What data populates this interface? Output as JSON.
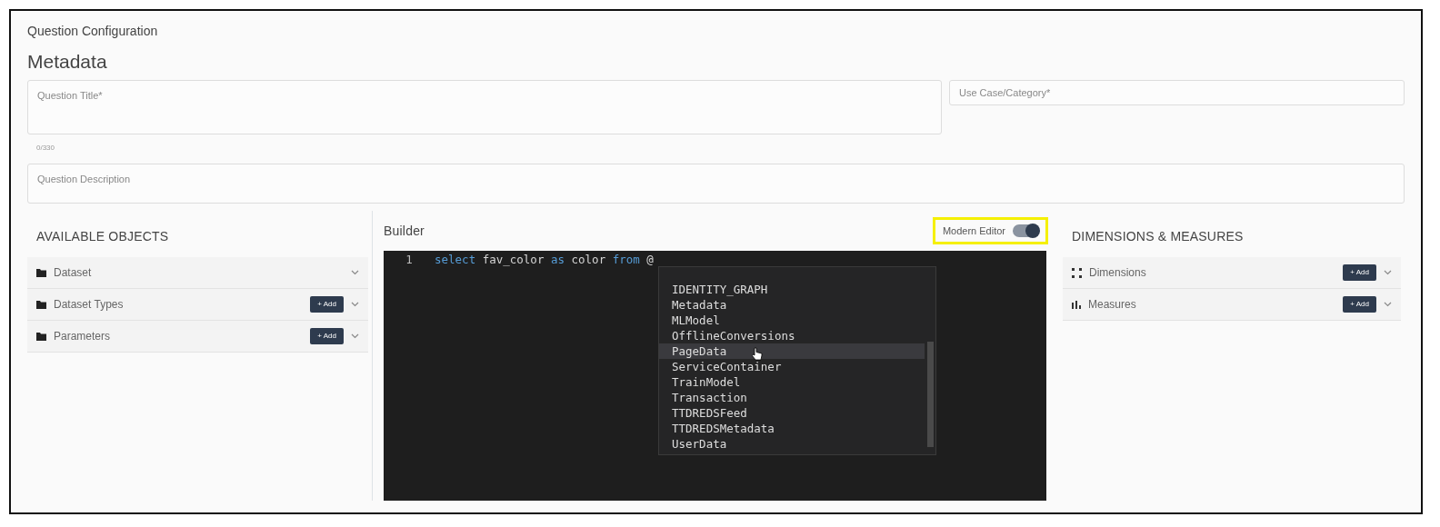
{
  "header": {
    "breadcrumb": "Question Configuration",
    "heading": "Metadata"
  },
  "metadata": {
    "title_field": {
      "placeholder": "Question Title*",
      "counter": "0/330"
    },
    "category_field": {
      "placeholder": "Use Case/Category*"
    },
    "description_field": {
      "placeholder": "Question Description"
    }
  },
  "available_objects": {
    "title": "AVAILABLE OBJECTS",
    "items": [
      {
        "label": "Dataset",
        "kind": "folder"
      },
      {
        "label": "Dataset Types",
        "kind": "folder",
        "add_button": "+ Add"
      },
      {
        "label": "Parameters",
        "kind": "folder",
        "add_button": "+ Add"
      }
    ]
  },
  "builder": {
    "title": "Builder",
    "toggle": {
      "label": "Modern Editor",
      "on": true,
      "highlighted": true
    },
    "editor": {
      "lines": [
        {
          "number": "1",
          "tokens": [
            {
              "text": "select",
              "kind": "keyword"
            },
            {
              "text": "fav_color",
              "kind": "ident"
            },
            {
              "text": "as",
              "kind": "keyword"
            },
            {
              "text": "color",
              "kind": "ident"
            },
            {
              "text": "from",
              "kind": "keyword"
            },
            {
              "text": "@",
              "kind": "ident"
            }
          ]
        }
      ],
      "autocomplete": [
        {
          "label": "IDENTITY_GRAPH",
          "hovered": false
        },
        {
          "label": "Metadata",
          "hovered": false
        },
        {
          "label": "MLModel",
          "hovered": false
        },
        {
          "label": "OfflineConversions",
          "hovered": false
        },
        {
          "label": "PageData",
          "hovered": true
        },
        {
          "label": "ServiceContainer",
          "hovered": false
        },
        {
          "label": "TrainModel",
          "hovered": false
        },
        {
          "label": "Transaction",
          "hovered": false
        },
        {
          "label": "TTDREDSFeed",
          "hovered": false
        },
        {
          "label": "TTDREDSMetadata",
          "hovered": false
        },
        {
          "label": "UserData",
          "hovered": false
        }
      ]
    }
  },
  "dimensions_measures": {
    "title": "DIMENSIONS & MEASURES",
    "items": [
      {
        "label": "Dimensions",
        "kind": "dimensions",
        "add_button": "+ Add"
      },
      {
        "label": "Measures",
        "kind": "measures",
        "add_button": "+ Add"
      }
    ]
  }
}
